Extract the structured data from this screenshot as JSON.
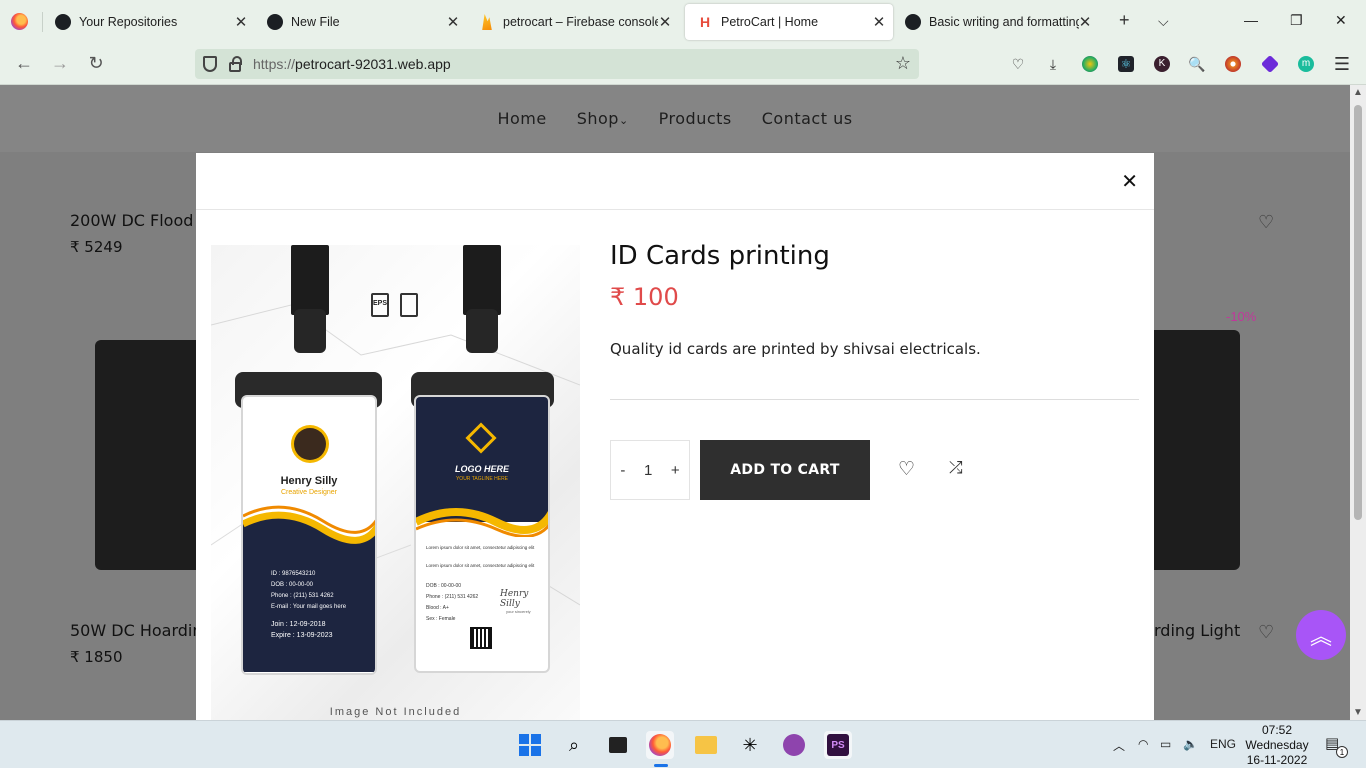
{
  "browser": {
    "tabs": [
      {
        "label": "Your Repositories",
        "icon": "github-icon",
        "active": false
      },
      {
        "label": "New File",
        "icon": "github-icon",
        "active": false
      },
      {
        "label": "petrocart – Firebase console",
        "icon": "firebase-icon",
        "active": false
      },
      {
        "label": "PetroCart | Home",
        "icon": "petrocart-icon",
        "active": true
      },
      {
        "label": "Basic writing and formatting",
        "icon": "github-icon",
        "active": false
      }
    ],
    "url_scheme": "https://",
    "url_host": "petrocart-92031.web.app",
    "extension_badge": "8"
  },
  "site": {
    "nav": [
      "Home",
      "Shop",
      "Products",
      "Contact us"
    ],
    "background_products": [
      {
        "title": "200W DC Flood",
        "price": "₹ 5249"
      },
      {
        "title": "50W DC Hoardin",
        "price": "₹ 1850"
      },
      {
        "title": "rding Light",
        "price": ""
      }
    ],
    "discount_badge": "-10%"
  },
  "modal": {
    "title": "ID Cards printing",
    "price": "₹ 100",
    "description": "Quality id cards are printed by shivsai electricals.",
    "quantity": "1",
    "qty_minus": "-",
    "qty_plus": "+",
    "add_to_cart": "ADD TO CART",
    "image": {
      "caption": "Image Not Included",
      "card_name": "Henry Silly",
      "card_role": "Creative Designer",
      "logo_text": "LOGO HERE",
      "tagline": "YOUR TAGLINE HERE",
      "eps_label": "EPS",
      "front_fields": [
        "ID      : 9876543210",
        "DOB    : 00-00-00",
        "Phone  : (211) 531 4262",
        "E-mail : Your mail goes here"
      ],
      "join": "Join      : 12-09-2018",
      "expire": "Expire   : 13-09-2023",
      "back_fields": [
        "DOB    : 00-00-00",
        "Phone  : (211) 531 4262",
        "Blood  : A+",
        "Sex     : Female"
      ],
      "lorem1": "Lorem ipsum dolor sit amet, consectetur adipiscing elit",
      "lorem2": "Lorem ipsum dolor sit amet, consectetur adipiscing elit",
      "signature": "Henry Silly",
      "sign_caption": "your sincerely"
    }
  },
  "taskbar": {
    "language": "ENG",
    "time": "07:52",
    "day": "Wednesday",
    "date": "16-11-2022",
    "notification_count": "1"
  },
  "colors": {
    "price_red": "#e04a4a",
    "add_to_cart_bg": "#2f2f2f",
    "scroll_top_purple": "#a855f7",
    "card_navy": "#1d2540",
    "card_yellow": "#f5b800"
  }
}
